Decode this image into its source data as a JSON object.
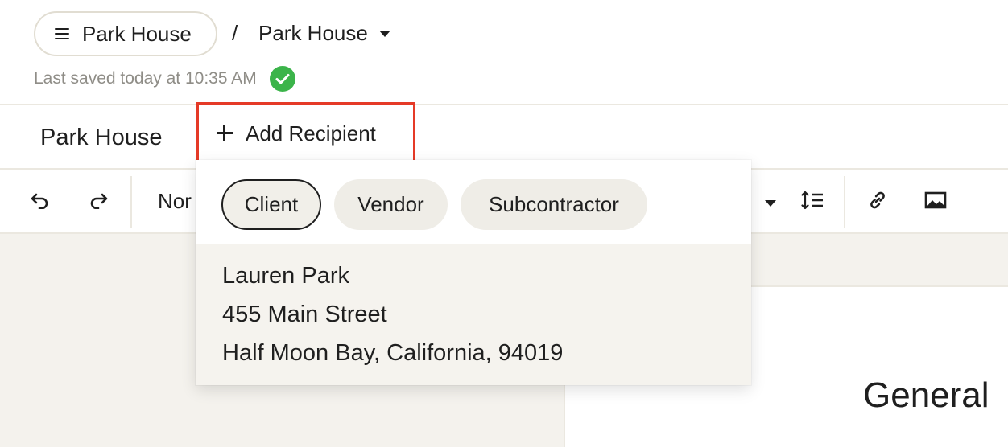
{
  "header": {
    "project_name": "Park House",
    "separator": "/",
    "current_document": "Park House",
    "last_saved": "Last saved today at 10:35 AM"
  },
  "title_row": {
    "document_title": "Park House",
    "add_recipient_label": "Add Recipient"
  },
  "toolbar": {
    "text_style_value": "Nor",
    "icons": [
      "undo-icon",
      "redo-icon",
      "chevron-down-icon",
      "line-spacing-icon",
      "link-icon",
      "image-icon"
    ]
  },
  "dropdown": {
    "tabs": [
      {
        "label": "Client",
        "active": true
      },
      {
        "label": "Vendor",
        "active": false
      },
      {
        "label": "Subcontractor",
        "active": false
      }
    ],
    "recipient": {
      "name": "Lauren Park",
      "street": "455 Main Street",
      "city_state_zip": "Half Moon Bay, California, 94019"
    }
  },
  "document": {
    "heading": "General"
  },
  "colors": {
    "highlight_border": "#e53a27",
    "saved_check": "#3bb44a",
    "chip_bg": "#efede7",
    "canvas_bg": "#f4f2ed"
  }
}
